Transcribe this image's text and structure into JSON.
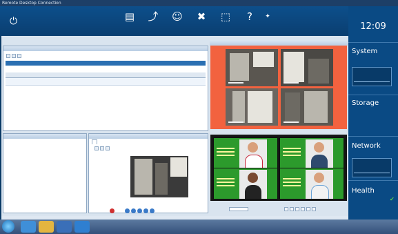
{
  "window": {
    "title": "Remote Desktop Connection"
  },
  "toolbar": {
    "labels": [
      "",
      "",
      "",
      "",
      "",
      ""
    ]
  },
  "menu": [
    "",
    "",
    ""
  ],
  "side": {
    "date": "",
    "time": "12:09",
    "system": "System",
    "storage": "Storage",
    "network": "Network",
    "health": "Health"
  },
  "panes": {
    "alarms": "",
    "operator_tab": ""
  },
  "camera": {
    "captions": [
      "",
      "",
      "",
      ""
    ]
  },
  "cards": [
    {
      "body_color": "#ffffff",
      "accent": "#c8283c"
    },
    {
      "body_color": "#2e4a6e",
      "accent": "#3a5f86"
    },
    {
      "body_color": "#232323",
      "accent": "#7a4a32"
    },
    {
      "body_color": "#f2f2f2",
      "accent": "#6aa3d6"
    }
  ],
  "taskbar": {
    "clock_time": "",
    "clock_date": ""
  },
  "colors": {
    "accent": "#0d4f8b",
    "orange": "#f2623f",
    "card_green": "#2c9a2c"
  }
}
